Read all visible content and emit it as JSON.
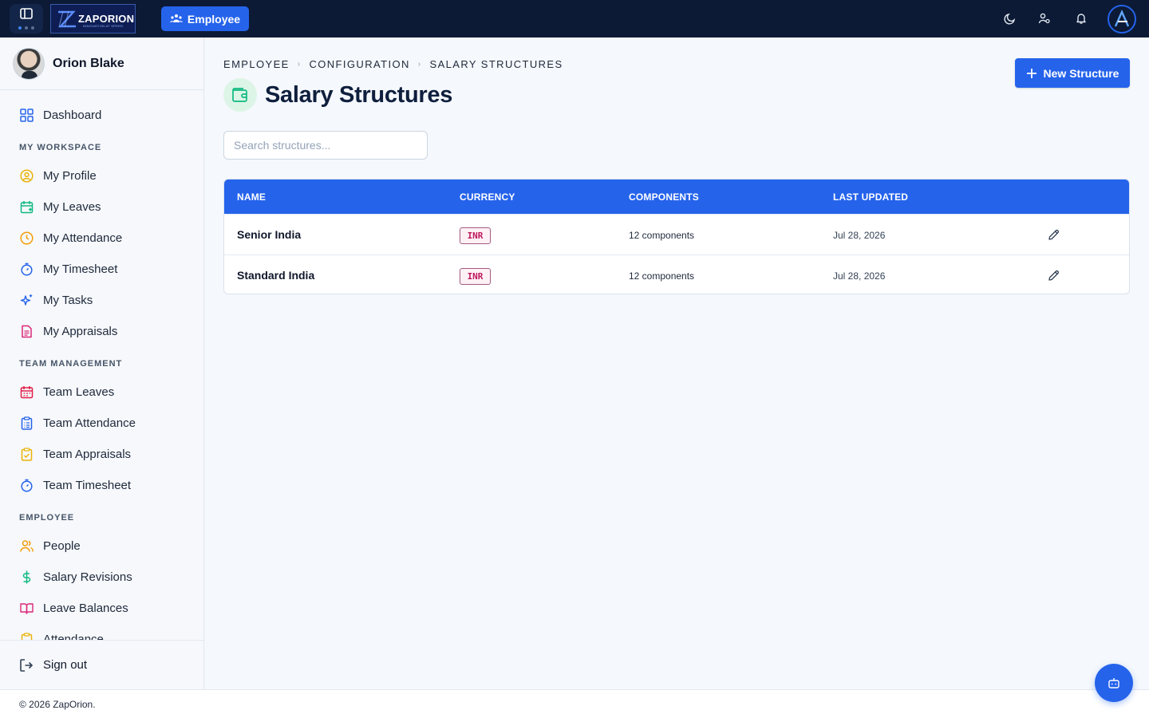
{
  "topbar": {
    "logo_text": "ZAPORION",
    "logo_tagline": "INNOVATION AT SPEED",
    "module_button": "Employee"
  },
  "user": {
    "name": "Orion Blake"
  },
  "sidebar": {
    "dashboard": "Dashboard",
    "sections": [
      {
        "title": "MY WORKSPACE",
        "items": [
          {
            "label": "My Profile",
            "icon": "user-circle-icon",
            "color": "#eab308"
          },
          {
            "label": "My Leaves",
            "icon": "calendar-plus-icon",
            "color": "#10b981"
          },
          {
            "label": "My Attendance",
            "icon": "clock-icon",
            "color": "#f59e0b"
          },
          {
            "label": "My Timesheet",
            "icon": "stopwatch-icon",
            "color": "#2563eb"
          },
          {
            "label": "My Tasks",
            "icon": "sparkles-icon",
            "color": "#2563eb"
          },
          {
            "label": "My Appraisals",
            "icon": "document-icon",
            "color": "#db2777"
          }
        ]
      },
      {
        "title": "TEAM MANAGEMENT",
        "items": [
          {
            "label": "Team Leaves",
            "icon": "calendar-icon",
            "color": "#e11d48"
          },
          {
            "label": "Team Attendance",
            "icon": "clipboard-list-icon",
            "color": "#2563eb"
          },
          {
            "label": "Team Appraisals",
            "icon": "clipboard-check-icon",
            "color": "#eab308"
          },
          {
            "label": "Team Timesheet",
            "icon": "stopwatch-icon",
            "color": "#2563eb"
          }
        ]
      },
      {
        "title": "EMPLOYEE",
        "items": [
          {
            "label": "People",
            "icon": "users-icon",
            "color": "#f59e0b"
          },
          {
            "label": "Salary Revisions",
            "icon": "dollar-icon",
            "color": "#10b981"
          },
          {
            "label": "Leave Balances",
            "icon": "book-open-icon",
            "color": "#db2777"
          },
          {
            "label": "Attendance",
            "icon": "clipboard-icon",
            "color": "#eab308"
          }
        ]
      }
    ],
    "signout": "Sign out"
  },
  "breadcrumb": [
    "EMPLOYEE",
    "CONFIGURATION",
    "SALARY STRUCTURES"
  ],
  "page": {
    "title": "Salary Structures",
    "new_button": "New Structure",
    "search_placeholder": "Search structures..."
  },
  "table": {
    "columns": [
      "NAME",
      "CURRENCY",
      "COMPONENTS",
      "LAST UPDATED"
    ],
    "rows": [
      {
        "name": "Senior India",
        "currency": "INR",
        "components": "12 components",
        "updated": "Jul 28, 2026"
      },
      {
        "name": "Standard India",
        "currency": "INR",
        "components": "12 components",
        "updated": "Jul 28, 2026"
      }
    ]
  },
  "footer": {
    "copyright": "© 2026 ZapOrion."
  },
  "colors": {
    "topbar": "#0c1a36",
    "accent": "#2563eb",
    "badge_text": "#be185d"
  }
}
